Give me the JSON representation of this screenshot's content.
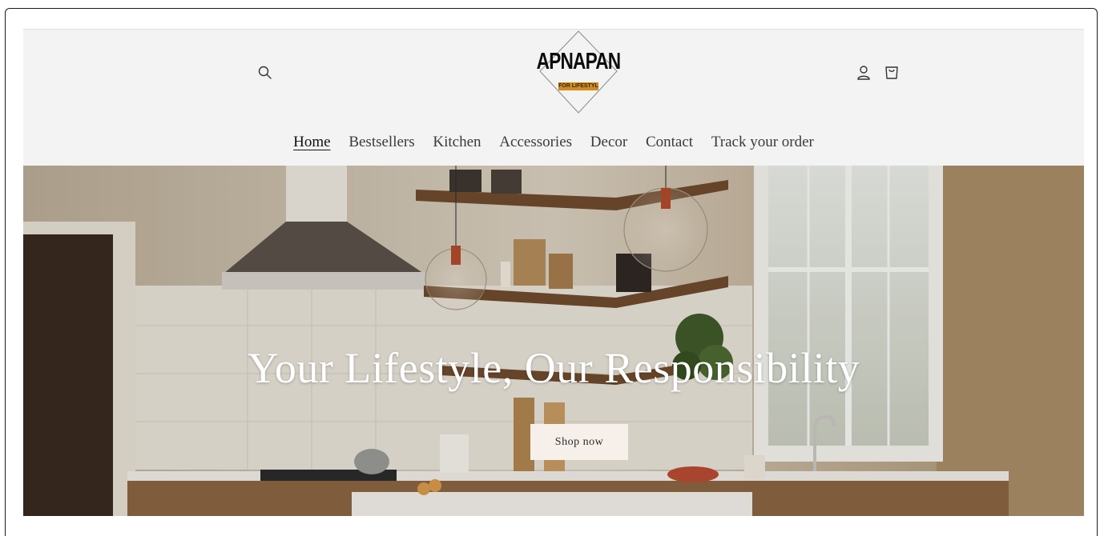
{
  "header": {
    "logo_text": "APNAPAN",
    "logo_tagline": "FOR LIFESTYLE"
  },
  "nav": {
    "items": [
      {
        "label": "Home",
        "active": true
      },
      {
        "label": "Bestsellers"
      },
      {
        "label": "Kitchen"
      },
      {
        "label": "Accessories"
      },
      {
        "label": "Decor"
      },
      {
        "label": "Contact"
      },
      {
        "label": "Track your order"
      }
    ]
  },
  "hero": {
    "title": "Your Lifestyle, Our Responsibility",
    "cta_label": "Shop now"
  },
  "icons": {
    "search": "search-icon",
    "account": "account-icon",
    "cart": "cart-icon"
  },
  "colors": {
    "header_bg": "#f3f3f3",
    "logo_accent": "#d08a1e",
    "cta_bg": "#f7f0ea"
  }
}
